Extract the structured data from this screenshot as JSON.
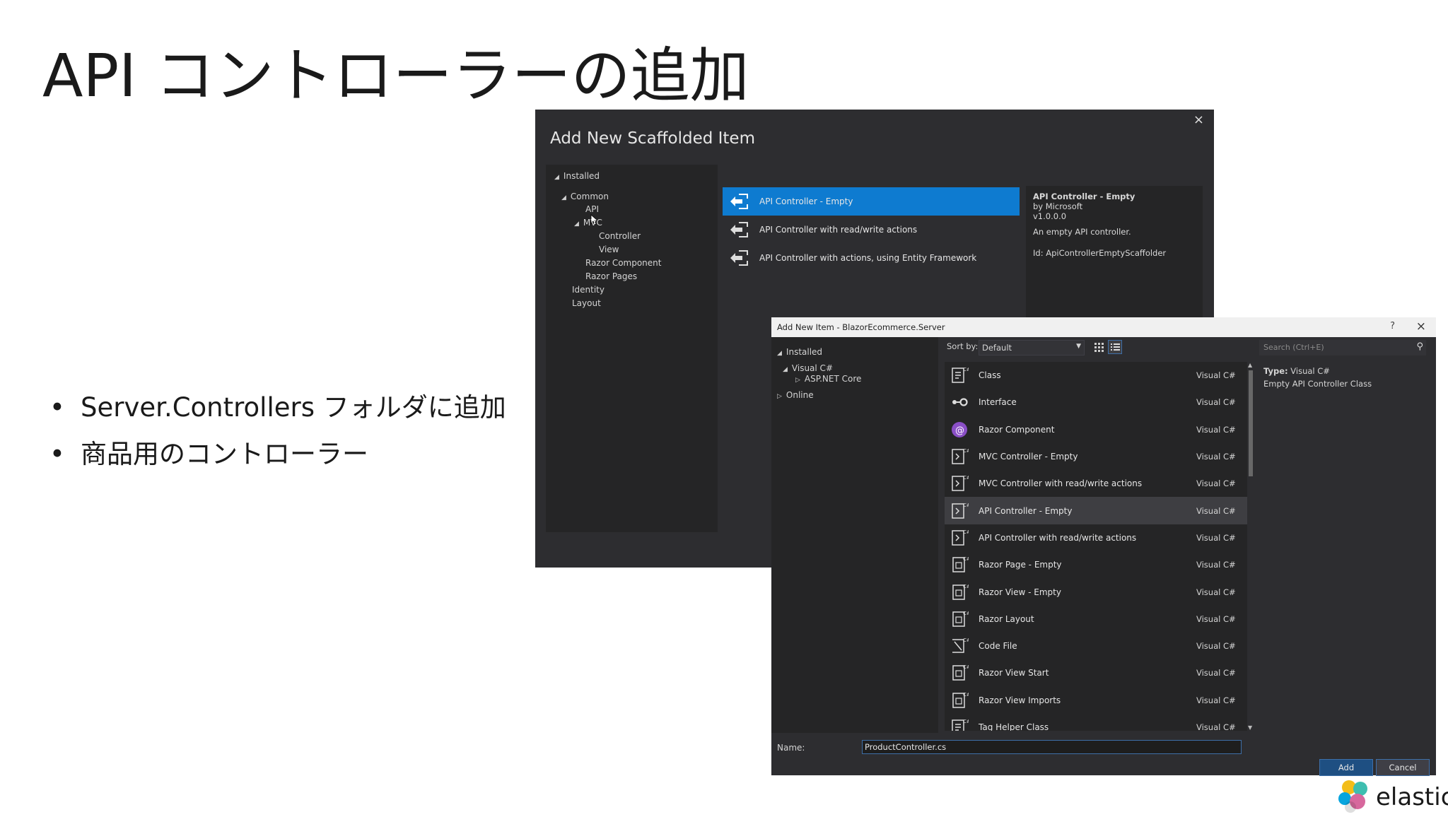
{
  "slide": {
    "title": "API コントローラーの追加",
    "bullets": [
      {
        "dot": "•",
        "text": "Server.Controllers フォルダに追加"
      },
      {
        "dot": "•",
        "text": "商品用のコントローラー"
      }
    ]
  },
  "scaffold_dialog": {
    "title": "Add New Scaffolded Item",
    "close_glyph": "×",
    "tree": {
      "installed": "Installed",
      "common": "Common",
      "api": "API",
      "mvc": "MVC",
      "controller": "Controller",
      "view": "View",
      "razor_component": "Razor Component",
      "razor_pages": "Razor Pages",
      "identity": "Identity",
      "layout": "Layout"
    },
    "items": [
      {
        "label": "API Controller - Empty",
        "selected": true
      },
      {
        "label": "API Controller with read/write actions",
        "selected": false
      },
      {
        "label": "API Controller with actions, using Entity Framework",
        "selected": false
      }
    ],
    "detail": {
      "name": "API Controller - Empty",
      "by": "by Microsoft",
      "version": "v1.0.0.0",
      "description": "An empty API controller.",
      "id": "Id: ApiControllerEmptyScaffolder"
    }
  },
  "add_item_dialog": {
    "title": "Add New Item - BlazorEcommerce.Server",
    "help_glyph": "?",
    "close_glyph": "×",
    "tree": {
      "installed": "Installed",
      "visual_csharp": "Visual C#",
      "aspnet_core": "ASP.NET Core",
      "online": "Online"
    },
    "sort_label": "Sort by:",
    "sort_value": "Default",
    "search_placeholder": "Search (Ctrl+E)",
    "items": [
      {
        "name": "Class",
        "type": "Visual C#",
        "icon": "class-icon",
        "selected": false
      },
      {
        "name": "Interface",
        "type": "Visual C#",
        "icon": "interface-icon",
        "selected": false
      },
      {
        "name": "Razor Component",
        "type": "Visual C#",
        "icon": "razor-component-icon",
        "selected": false
      },
      {
        "name": "MVC Controller - Empty",
        "type": "Visual C#",
        "icon": "controller-icon",
        "selected": false
      },
      {
        "name": "MVC Controller with read/write actions",
        "type": "Visual C#",
        "icon": "controller-icon",
        "selected": false
      },
      {
        "name": "API Controller - Empty",
        "type": "Visual C#",
        "icon": "controller-icon",
        "selected": true
      },
      {
        "name": "API Controller with read/write actions",
        "type": "Visual C#",
        "icon": "controller-icon",
        "selected": false
      },
      {
        "name": "Razor Page - Empty",
        "type": "Visual C#",
        "icon": "razor-page-icon",
        "selected": false
      },
      {
        "name": "Razor View - Empty",
        "type": "Visual C#",
        "icon": "razor-page-icon",
        "selected": false
      },
      {
        "name": "Razor Layout",
        "type": "Visual C#",
        "icon": "razor-page-icon",
        "selected": false
      },
      {
        "name": "Code File",
        "type": "Visual C#",
        "icon": "code-file-icon",
        "selected": false
      },
      {
        "name": "Razor View Start",
        "type": "Visual C#",
        "icon": "razor-page-icon",
        "selected": false
      },
      {
        "name": "Razor View Imports",
        "type": "Visual C#",
        "icon": "razor-page-icon",
        "selected": false
      },
      {
        "name": "Tag Helper Class",
        "type": "Visual C#",
        "icon": "class-icon",
        "selected": false
      }
    ],
    "info_type_label": "Type:",
    "info_type_value": "Visual C#",
    "info_description": "Empty API Controller Class",
    "name_label": "Name:",
    "name_value": "ProductController.cs",
    "add_label": "Add",
    "cancel_label": "Cancel"
  },
  "logo": {
    "wordmark": "elastic"
  },
  "colors": {
    "selected_blue": "#0e7bd0",
    "dark_bg": "#2d2d30",
    "panel_bg": "#252526"
  }
}
